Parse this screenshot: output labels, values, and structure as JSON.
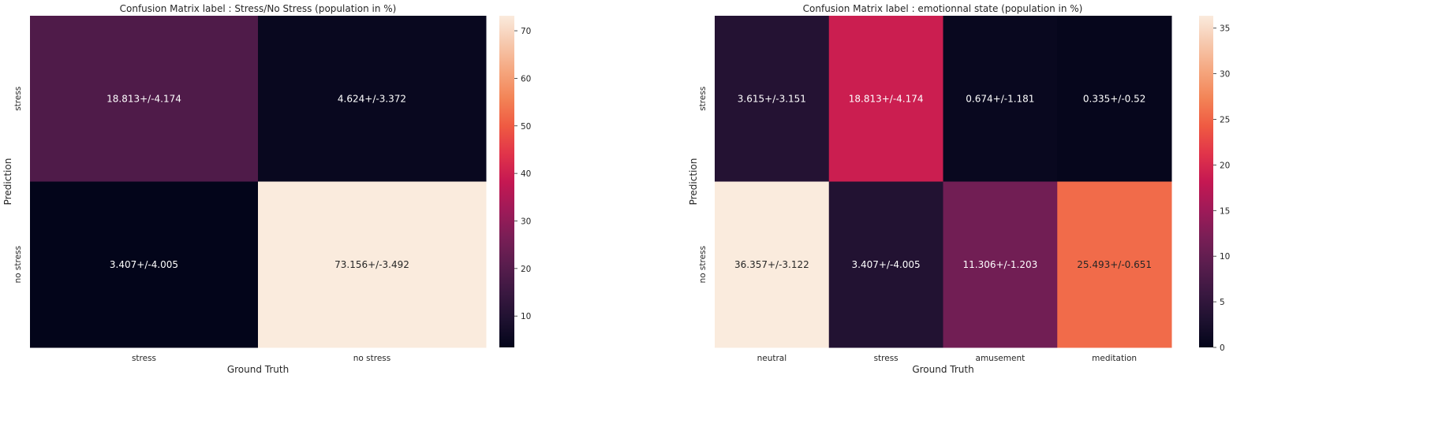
{
  "chart_data": [
    {
      "type": "heatmap",
      "title": "Confusion Matrix label : Stress/No Stress (population in %)",
      "xlabel": "Ground Truth",
      "ylabel": "Prediction",
      "x_categories": [
        "stress",
        "no stress"
      ],
      "y_categories": [
        "stress",
        "no stress"
      ],
      "values": [
        [
          18.813,
          4.624
        ],
        [
          3.407,
          73.156
        ]
      ],
      "errors": [
        [
          4.174,
          3.372
        ],
        [
          4.005,
          3.492
        ]
      ],
      "annotations": [
        [
          "18.813+/-4.174",
          "4.624+/-3.372"
        ],
        [
          "3.407+/-4.005",
          "73.156+/-3.492"
        ]
      ],
      "colorbar": {
        "colormap": "rocket",
        "range": [
          3.407,
          73.156
        ],
        "ticks": [
          10,
          20,
          30,
          40,
          50,
          60,
          70
        ]
      }
    },
    {
      "type": "heatmap",
      "title": "Confusion Matrix label : emotionnal state (population in %)",
      "xlabel": "Ground Truth",
      "ylabel": "Prediction",
      "x_categories": [
        "neutral",
        "stress",
        "amusement",
        "meditation"
      ],
      "y_categories": [
        "stress",
        "no stress"
      ],
      "values": [
        [
          3.615,
          18.813,
          0.674,
          0.335
        ],
        [
          36.357,
          3.407,
          11.306,
          25.493
        ]
      ],
      "errors": [
        [
          3.151,
          4.174,
          1.181,
          0.52
        ],
        [
          3.122,
          4.005,
          1.203,
          0.651
        ]
      ],
      "annotations": [
        [
          "3.615+/-3.151",
          "18.813+/-4.174",
          "0.674+/-1.181",
          "0.335+/-0.52"
        ],
        [
          "36.357+/-3.122",
          "3.407+/-4.005",
          "11.306+/-1.203",
          "25.493+/-0.651"
        ]
      ],
      "colorbar": {
        "colormap": "rocket",
        "range": [
          0,
          36.357
        ],
        "ticks": [
          0,
          5,
          10,
          15,
          20,
          25,
          30,
          35
        ]
      }
    }
  ],
  "colors": {
    "rocket_stops": [
      "#03051a",
      "#1e1130",
      "#3b1841",
      "#5a1d4e",
      "#7a1e56",
      "#a01a58",
      "#c51852",
      "#e1344a",
      "#ef5a42",
      "#f38356",
      "#f5a67e",
      "#f6c8ad",
      "#faebdd"
    ],
    "dark_text": "#262626",
    "light_text": "#ffffff"
  }
}
